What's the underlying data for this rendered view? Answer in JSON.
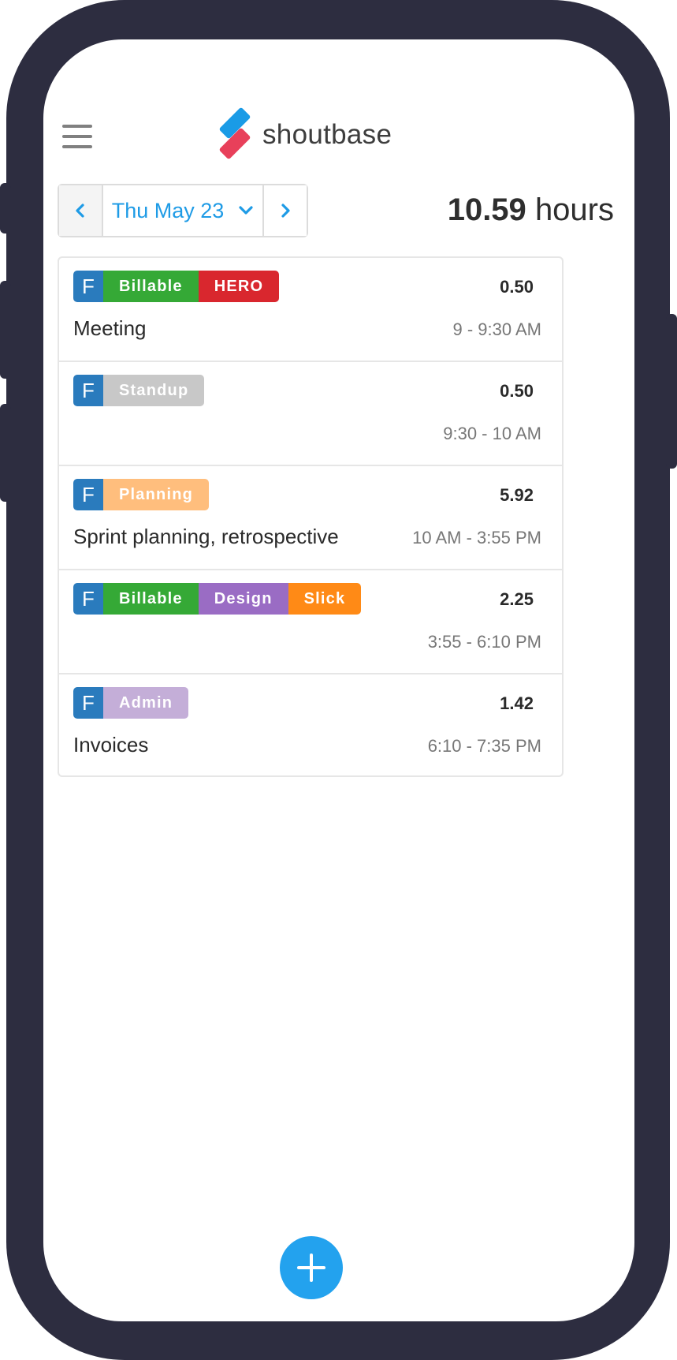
{
  "app": {
    "name": "shoutbase"
  },
  "date_nav": {
    "date_label": "Thu May 23"
  },
  "summary": {
    "total_hours": "10.59",
    "unit": "hours"
  },
  "entries": [
    {
      "tags": [
        {
          "label": "F",
          "color": "#2a7bbd"
        },
        {
          "label": "Billable",
          "color": "#35a936"
        },
        {
          "label": "HERO",
          "color": "#d9272e"
        }
      ],
      "hours": "0.50",
      "description": "Meeting",
      "time_range": "9 - 9:30 AM"
    },
    {
      "tags": [
        {
          "label": "F",
          "color": "#2a7bbd"
        },
        {
          "label": "Standup",
          "color": "#c8c8c8"
        }
      ],
      "hours": "0.50",
      "description": "",
      "time_range": "9:30 - 10 AM"
    },
    {
      "tags": [
        {
          "label": "F",
          "color": "#2a7bbd"
        },
        {
          "label": "Planning",
          "color": "#ffbe7d"
        }
      ],
      "hours": "5.92",
      "description": "Sprint planning, retrospective",
      "time_range": "10 AM - 3:55 PM"
    },
    {
      "tags": [
        {
          "label": "F",
          "color": "#2a7bbd"
        },
        {
          "label": "Billable",
          "color": "#35a936"
        },
        {
          "label": "Design",
          "color": "#9a6cc4"
        },
        {
          "label": "Slick",
          "color": "#ff8a16"
        }
      ],
      "hours": "2.25",
      "description": "",
      "time_range": "3:55 - 6:10 PM"
    },
    {
      "tags": [
        {
          "label": "F",
          "color": "#2a7bbd"
        },
        {
          "label": "Admin",
          "color": "#c4aed8"
        }
      ],
      "hours": "1.42",
      "description": "Invoices",
      "time_range": "6:10 - 7:35 PM"
    }
  ],
  "icons": {
    "menu": "hamburger-icon",
    "prev": "chevron-left-icon",
    "next": "chevron-right-icon",
    "dropdown": "chevron-down-icon",
    "add": "plus-icon"
  },
  "colors": {
    "accent": "#1e9be6",
    "fab": "#23a2ee",
    "frame": "#2d2d40"
  }
}
